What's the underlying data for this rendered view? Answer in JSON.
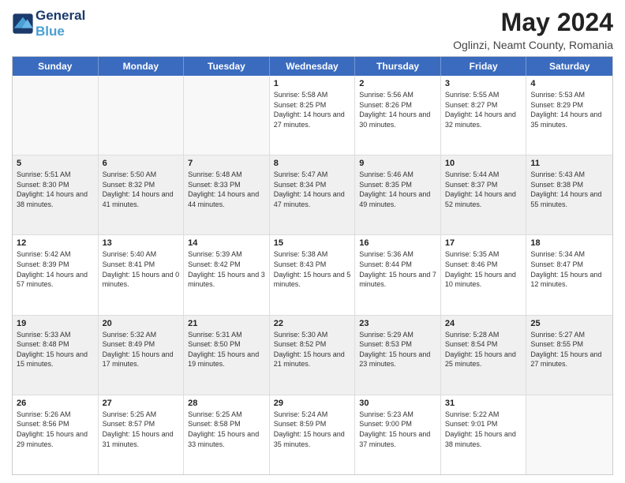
{
  "header": {
    "logo_line1": "General",
    "logo_line2": "Blue",
    "title": "May 2024",
    "subtitle": "Oglinzi, Neamt County, Romania"
  },
  "weekdays": [
    "Sunday",
    "Monday",
    "Tuesday",
    "Wednesday",
    "Thursday",
    "Friday",
    "Saturday"
  ],
  "rows": [
    [
      {
        "day": "",
        "sunrise": "",
        "sunset": "",
        "daylight": ""
      },
      {
        "day": "",
        "sunrise": "",
        "sunset": "",
        "daylight": ""
      },
      {
        "day": "",
        "sunrise": "",
        "sunset": "",
        "daylight": ""
      },
      {
        "day": "1",
        "sunrise": "Sunrise: 5:58 AM",
        "sunset": "Sunset: 8:25 PM",
        "daylight": "Daylight: 14 hours and 27 minutes."
      },
      {
        "day": "2",
        "sunrise": "Sunrise: 5:56 AM",
        "sunset": "Sunset: 8:26 PM",
        "daylight": "Daylight: 14 hours and 30 minutes."
      },
      {
        "day": "3",
        "sunrise": "Sunrise: 5:55 AM",
        "sunset": "Sunset: 8:27 PM",
        "daylight": "Daylight: 14 hours and 32 minutes."
      },
      {
        "day": "4",
        "sunrise": "Sunrise: 5:53 AM",
        "sunset": "Sunset: 8:29 PM",
        "daylight": "Daylight: 14 hours and 35 minutes."
      }
    ],
    [
      {
        "day": "5",
        "sunrise": "Sunrise: 5:51 AM",
        "sunset": "Sunset: 8:30 PM",
        "daylight": "Daylight: 14 hours and 38 minutes."
      },
      {
        "day": "6",
        "sunrise": "Sunrise: 5:50 AM",
        "sunset": "Sunset: 8:32 PM",
        "daylight": "Daylight: 14 hours and 41 minutes."
      },
      {
        "day": "7",
        "sunrise": "Sunrise: 5:48 AM",
        "sunset": "Sunset: 8:33 PM",
        "daylight": "Daylight: 14 hours and 44 minutes."
      },
      {
        "day": "8",
        "sunrise": "Sunrise: 5:47 AM",
        "sunset": "Sunset: 8:34 PM",
        "daylight": "Daylight: 14 hours and 47 minutes."
      },
      {
        "day": "9",
        "sunrise": "Sunrise: 5:46 AM",
        "sunset": "Sunset: 8:35 PM",
        "daylight": "Daylight: 14 hours and 49 minutes."
      },
      {
        "day": "10",
        "sunrise": "Sunrise: 5:44 AM",
        "sunset": "Sunset: 8:37 PM",
        "daylight": "Daylight: 14 hours and 52 minutes."
      },
      {
        "day": "11",
        "sunrise": "Sunrise: 5:43 AM",
        "sunset": "Sunset: 8:38 PM",
        "daylight": "Daylight: 14 hours and 55 minutes."
      }
    ],
    [
      {
        "day": "12",
        "sunrise": "Sunrise: 5:42 AM",
        "sunset": "Sunset: 8:39 PM",
        "daylight": "Daylight: 14 hours and 57 minutes."
      },
      {
        "day": "13",
        "sunrise": "Sunrise: 5:40 AM",
        "sunset": "Sunset: 8:41 PM",
        "daylight": "Daylight: 15 hours and 0 minutes."
      },
      {
        "day": "14",
        "sunrise": "Sunrise: 5:39 AM",
        "sunset": "Sunset: 8:42 PM",
        "daylight": "Daylight: 15 hours and 3 minutes."
      },
      {
        "day": "15",
        "sunrise": "Sunrise: 5:38 AM",
        "sunset": "Sunset: 8:43 PM",
        "daylight": "Daylight: 15 hours and 5 minutes."
      },
      {
        "day": "16",
        "sunrise": "Sunrise: 5:36 AM",
        "sunset": "Sunset: 8:44 PM",
        "daylight": "Daylight: 15 hours and 7 minutes."
      },
      {
        "day": "17",
        "sunrise": "Sunrise: 5:35 AM",
        "sunset": "Sunset: 8:46 PM",
        "daylight": "Daylight: 15 hours and 10 minutes."
      },
      {
        "day": "18",
        "sunrise": "Sunrise: 5:34 AM",
        "sunset": "Sunset: 8:47 PM",
        "daylight": "Daylight: 15 hours and 12 minutes."
      }
    ],
    [
      {
        "day": "19",
        "sunrise": "Sunrise: 5:33 AM",
        "sunset": "Sunset: 8:48 PM",
        "daylight": "Daylight: 15 hours and 15 minutes."
      },
      {
        "day": "20",
        "sunrise": "Sunrise: 5:32 AM",
        "sunset": "Sunset: 8:49 PM",
        "daylight": "Daylight: 15 hours and 17 minutes."
      },
      {
        "day": "21",
        "sunrise": "Sunrise: 5:31 AM",
        "sunset": "Sunset: 8:50 PM",
        "daylight": "Daylight: 15 hours and 19 minutes."
      },
      {
        "day": "22",
        "sunrise": "Sunrise: 5:30 AM",
        "sunset": "Sunset: 8:52 PM",
        "daylight": "Daylight: 15 hours and 21 minutes."
      },
      {
        "day": "23",
        "sunrise": "Sunrise: 5:29 AM",
        "sunset": "Sunset: 8:53 PM",
        "daylight": "Daylight: 15 hours and 23 minutes."
      },
      {
        "day": "24",
        "sunrise": "Sunrise: 5:28 AM",
        "sunset": "Sunset: 8:54 PM",
        "daylight": "Daylight: 15 hours and 25 minutes."
      },
      {
        "day": "25",
        "sunrise": "Sunrise: 5:27 AM",
        "sunset": "Sunset: 8:55 PM",
        "daylight": "Daylight: 15 hours and 27 minutes."
      }
    ],
    [
      {
        "day": "26",
        "sunrise": "Sunrise: 5:26 AM",
        "sunset": "Sunset: 8:56 PM",
        "daylight": "Daylight: 15 hours and 29 minutes."
      },
      {
        "day": "27",
        "sunrise": "Sunrise: 5:25 AM",
        "sunset": "Sunset: 8:57 PM",
        "daylight": "Daylight: 15 hours and 31 minutes."
      },
      {
        "day": "28",
        "sunrise": "Sunrise: 5:25 AM",
        "sunset": "Sunset: 8:58 PM",
        "daylight": "Daylight: 15 hours and 33 minutes."
      },
      {
        "day": "29",
        "sunrise": "Sunrise: 5:24 AM",
        "sunset": "Sunset: 8:59 PM",
        "daylight": "Daylight: 15 hours and 35 minutes."
      },
      {
        "day": "30",
        "sunrise": "Sunrise: 5:23 AM",
        "sunset": "Sunset: 9:00 PM",
        "daylight": "Daylight: 15 hours and 37 minutes."
      },
      {
        "day": "31",
        "sunrise": "Sunrise: 5:22 AM",
        "sunset": "Sunset: 9:01 PM",
        "daylight": "Daylight: 15 hours and 38 minutes."
      },
      {
        "day": "",
        "sunrise": "",
        "sunset": "",
        "daylight": ""
      }
    ]
  ]
}
